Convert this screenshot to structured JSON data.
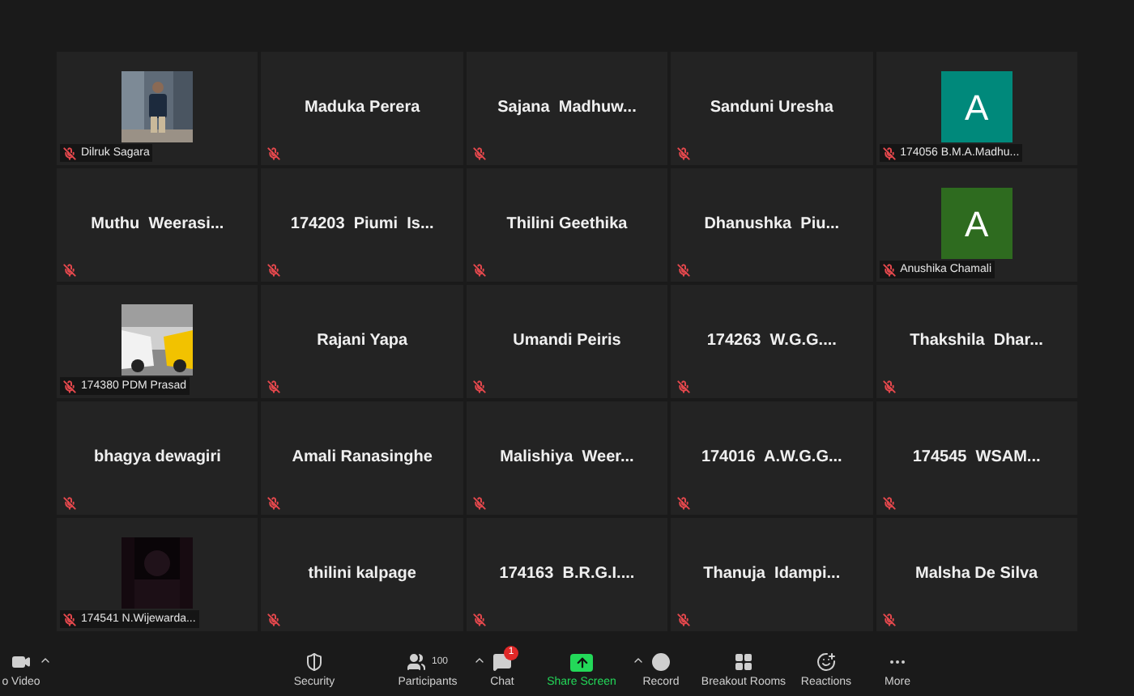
{
  "tiles": [
    {
      "name": "Dilruk Sagara",
      "muted": true
    },
    {
      "kind": "name",
      "name": "Maduka Perera",
      "muted": true
    },
    {
      "kind": "name",
      "name": "Sajana  Madhuw...",
      "muted": true
    },
    {
      "kind": "name",
      "name": "Sanduni Uresha",
      "muted": true
    },
    {
      "kind": "avatar",
      "letter": "A",
      "color": "#00897b",
      "name": "174056 B.M.A.Madhu...",
      "muted": true
    },
    {
      "kind": "name",
      "name": "Muthu  Weerasi...",
      "muted": true
    },
    {
      "kind": "name",
      "name": "174203  Piumi  Is...",
      "muted": true
    },
    {
      "kind": "name",
      "name": "Thilini Geethika",
      "muted": true
    },
    {
      "kind": "name",
      "name": "Dhanushka  Piu...",
      "muted": true
    },
    {
      "kind": "avatar",
      "letter": "A",
      "color": "#2e6b1f",
      "name": "Anushika Chamali",
      "muted": true
    },
    {
      "name": "174380 PDM Prasad",
      "muted": true
    },
    {
      "kind": "name",
      "name": "Rajani Yapa",
      "muted": true
    },
    {
      "kind": "name",
      "name": "Umandi Peiris",
      "muted": true
    },
    {
      "kind": "name",
      "name": "174263  W.G.G....",
      "muted": true
    },
    {
      "kind": "name",
      "name": "Thakshila  Dhar...",
      "muted": true
    },
    {
      "kind": "name",
      "name": "bhagya dewagiri",
      "muted": true
    },
    {
      "kind": "name",
      "name": "Amali Ranasinghe",
      "muted": true
    },
    {
      "kind": "name",
      "name": "Malishiya  Weer...",
      "muted": true
    },
    {
      "kind": "name",
      "name": "174016  A.W.G.G...",
      "muted": true
    },
    {
      "kind": "name",
      "name": "174545  WSAM...",
      "muted": true
    },
    {
      "name": "174541 N.Wijewarda...",
      "muted": true
    },
    {
      "kind": "name",
      "name": "thilini kalpage",
      "muted": true
    },
    {
      "kind": "name",
      "name": "174163  B.R.G.I....",
      "muted": true
    },
    {
      "kind": "name",
      "name": "Thanuja  Idampi...",
      "muted": true
    },
    {
      "kind": "name",
      "name": "Malsha De Silva",
      "muted": true
    }
  ],
  "toolbar": [
    {
      "kind": "video",
      "label": "o Video",
      "caret": true,
      "highlighted": false
    },
    {
      "kind": "security",
      "label": "Security",
      "caret": false,
      "highlighted": false
    },
    {
      "kind": "participants",
      "label": "Participants",
      "count": "100",
      "caret": true,
      "highlighted": false
    },
    {
      "kind": "chat",
      "label": "Chat",
      "badge": "1",
      "caret": false,
      "highlighted": false
    },
    {
      "kind": "share",
      "label": "Share Screen",
      "caret": true,
      "highlighted": true
    },
    {
      "kind": "record",
      "label": "Record",
      "caret": false,
      "highlighted": false
    },
    {
      "kind": "breakout",
      "label": "Breakout Rooms",
      "caret": false,
      "highlighted": false
    },
    {
      "kind": "reactions",
      "label": "Reactions",
      "caret": false,
      "highlighted": false
    },
    {
      "kind": "more",
      "label": "More",
      "caret": false,
      "highlighted": false
    }
  ]
}
